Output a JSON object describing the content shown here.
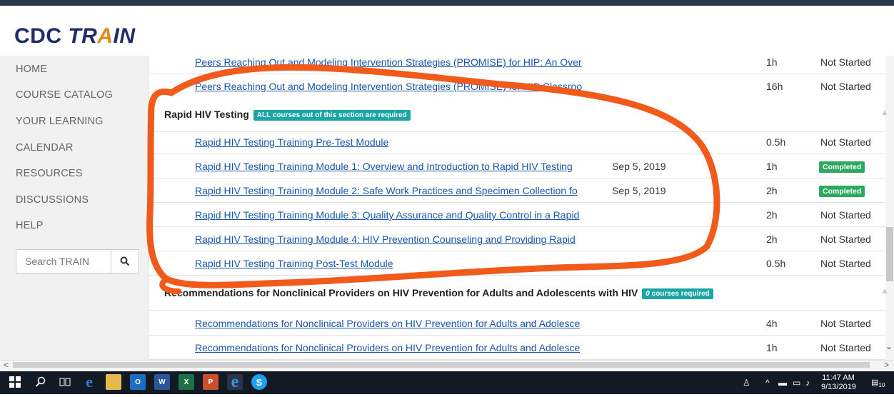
{
  "brand": {
    "part1": "CDC ",
    "part2": "TR",
    "part3": "A",
    "part4": "IN"
  },
  "sidebar": {
    "items": [
      {
        "label": "HOME"
      },
      {
        "label": "COURSE CATALOG"
      },
      {
        "label": "YOUR LEARNING"
      },
      {
        "label": "CALENDAR"
      },
      {
        "label": "RESOURCES"
      },
      {
        "label": "DISCUSSIONS"
      },
      {
        "label": "HELP"
      }
    ],
    "search_placeholder": "Search TRAIN"
  },
  "main": {
    "top_rows": [
      {
        "title": "Peers Reaching Out and Modeling Intervention Strategies (PROMISE) for HIP: An Over",
        "hours": "1h",
        "status": "Not Started"
      },
      {
        "title": "Peers Reaching Out and Modeling Intervention Strategies (PROMISE) for HIP Classroo",
        "hours": "16h",
        "status": "Not Started"
      }
    ],
    "section1": {
      "title": "Rapid HIV Testing",
      "badge": "ALL courses out of this section are required",
      "rows": [
        {
          "title": "Rapid HIV Testing Training Pre-Test Module",
          "date": "",
          "hours": "0.5h",
          "status": "Not Started"
        },
        {
          "title": "Rapid HIV Testing Training Module 1: Overview and Introduction to Rapid HIV Testing",
          "date": "Sep 5, 2019",
          "hours": "1h",
          "status": "Completed"
        },
        {
          "title": "Rapid HIV Testing Training Module 2: Safe Work Practices and Specimen Collection fo",
          "date": "Sep 5, 2019",
          "hours": "2h",
          "status": "Completed"
        },
        {
          "title": "Rapid HIV Testing Training Module 3: Quality Assurance and Quality Control in a Rapid",
          "date": "",
          "hours": "2h",
          "status": "Not Started"
        },
        {
          "title": "Rapid HIV Testing Training Module 4: HIV Prevention Counseling and Providing Rapid",
          "date": "",
          "hours": "2h",
          "status": "Not Started"
        },
        {
          "title": "Rapid HIV Testing Training Post-Test Module",
          "date": "",
          "hours": "0.5h",
          "status": "Not Started"
        }
      ]
    },
    "section2": {
      "title": "Recommendations for Nonclinical Providers on HIV Prevention for Adults and Adolescents with HIV",
      "badge_num": "0",
      "badge_text": " courses required",
      "rows": [
        {
          "title": "Recommendations for Nonclinical Providers on HIV Prevention for Adults and Adolesce",
          "hours": "4h",
          "status": "Not Started"
        },
        {
          "title": "Recommendations for Nonclinical Providers on HIV Prevention for Adults and Adolesce",
          "hours": "1h",
          "status": "Not Started"
        }
      ]
    }
  },
  "taskbar": {
    "time": "11:47 AM",
    "date": "9/13/2019",
    "notifications": "10"
  },
  "colors": {
    "link": "#1a55a8",
    "completed": "#2eaa5f",
    "required_badge": "#1aa6a6",
    "annotation": "#f05a1a",
    "brand": "#1f2b6b",
    "brand_accent": "#e08a1e"
  }
}
